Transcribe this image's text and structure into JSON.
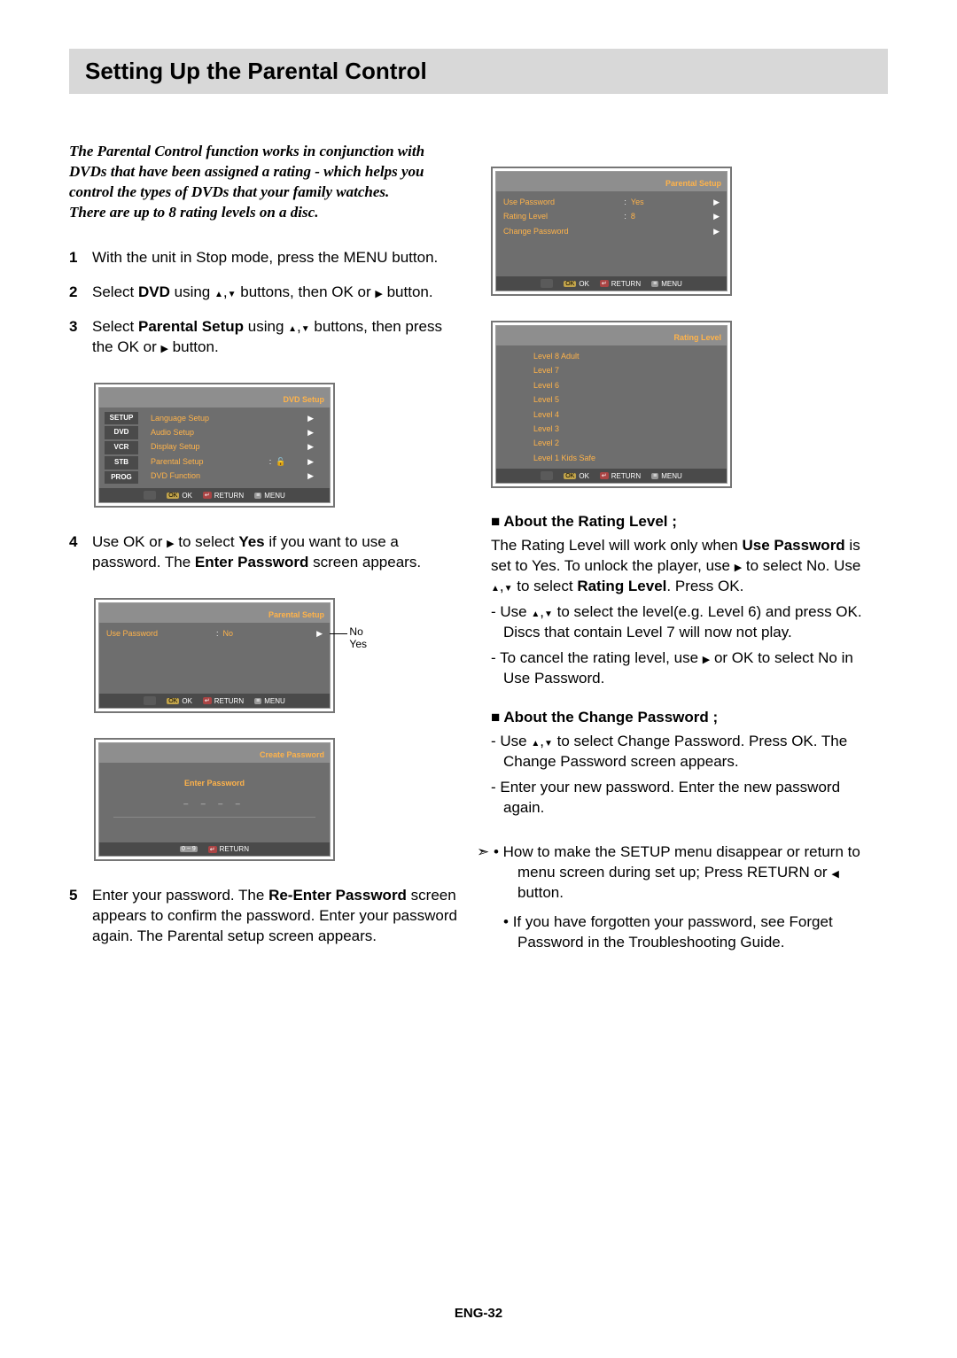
{
  "page": {
    "title": "Setting Up the Parental Control",
    "footer": "ENG-32",
    "intro_line1": "The Parental Control function works in conjunction with DVDs that have been assigned a rating - which helps you control the types of DVDs that your family watches.",
    "intro_line2": "There are up to 8 rating levels on a disc."
  },
  "steps": {
    "s1": "With the unit in Stop mode, press the MENU button.",
    "s2_pre": "Select ",
    "s2_bold": "DVD",
    "s2_mid": " using ",
    "s2_end": " buttons, then OK or ",
    "s2_end2": " button.",
    "s3_pre": "Select ",
    "s3_bold": "Parental Setup",
    "s3_mid": " using ",
    "s3_end": " buttons, then press the OK or ",
    "s3_end2": " button.",
    "s4_pre": "Use OK or ",
    "s4_mid": " to select ",
    "s4_bold": "Yes",
    "s4_mid2": " if you want to use a password. The ",
    "s4_bold2": "Enter Password",
    "s4_end": " screen appears.",
    "s5_pre": "Enter your password. The ",
    "s5_bold": "Re-Enter Password",
    "s5_end": " screen appears to confirm the password. Enter your password again. The Parental setup screen appears."
  },
  "osd_labels": {
    "ok": "OK",
    "return": "RETURN",
    "menu": "MENU"
  },
  "osd1": {
    "title": "DVD Setup",
    "tabs": [
      "SETUP",
      "DVD",
      "VCR",
      "STB",
      "PROG"
    ],
    "rows": [
      "Language Setup",
      "Audio Setup",
      "Display Setup",
      "Parental Setup",
      "DVD Function"
    ]
  },
  "osd2": {
    "title": "Parental Setup",
    "row": "Use Password",
    "val": "No",
    "popup1": "No",
    "popup2": "Yes"
  },
  "osd3": {
    "title": "Create Password",
    "label": "Enter Password",
    "dashes": "– – – –",
    "numhint": "0 ~ 9"
  },
  "osd4": {
    "title": "Parental Setup",
    "r1": "Use Password",
    "v1": "Yes",
    "r2": "Rating Level",
    "v2": "8",
    "r3": "Change Password"
  },
  "osd5": {
    "title": "Rating Level",
    "levels": [
      "Level  8  Adult",
      "Level  7",
      "Level  6",
      "Level  5",
      "Level  4",
      "Level  3",
      "Level  2",
      "Level  1  Kids Safe"
    ]
  },
  "right": {
    "h1": "About the Rating Level ;",
    "p1a": "The Rating Level will work only when ",
    "p1b": "Use Password",
    "p1c": " is set to Yes. To unlock the player, use ",
    "p1d": " to select No. Use ",
    "p1e": " to select ",
    "p1f": "Rating Level",
    "p1g": ". Press OK.",
    "li1a": "Use ",
    "li1b": " to select the level(e.g. Level 6) and press OK. Discs that contain Level 7 will now not play.",
    "li2a": "To cancel the rating level, use ",
    "li2b": " or OK to select No in Use Password.",
    "h2": "About the Change Password ;",
    "li3a": "Use ",
    "li3b": " to select Change Password. Press OK. The Change Password screen appears.",
    "li4": "Enter your new password. Enter the new password again.",
    "tip1a": "How to make the SETUP menu disappear or return to menu screen during set up; Press RETURN or ",
    "tip1b": " button.",
    "tip2": "If you have forgotten your password, see Forget Password in the Troubleshooting Guide."
  }
}
